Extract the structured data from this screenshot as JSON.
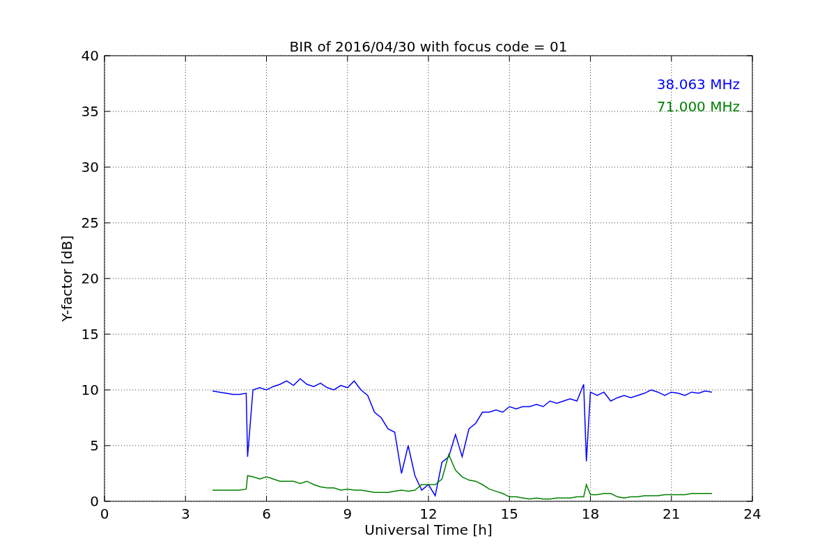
{
  "figure": {
    "chart_data": {
      "type": "line",
      "title": "BIR of 2016/04/30 with focus code = 01",
      "xlabel": "Universal Time [h]",
      "ylabel": "Y-factor [dB]",
      "x": [
        4,
        4.25,
        4.5,
        4.75,
        5,
        5.25,
        5.3,
        5.5,
        5.75,
        6,
        6.25,
        6.5,
        6.75,
        7,
        7.25,
        7.5,
        7.75,
        8,
        8.25,
        8.5,
        8.75,
        9,
        9.25,
        9.5,
        9.75,
        10,
        10.25,
        10.5,
        10.75,
        11,
        11.25,
        11.5,
        11.75,
        12,
        12.25,
        12.5,
        12.75,
        13,
        13.25,
        13.5,
        13.75,
        14,
        14.25,
        14.5,
        14.75,
        15,
        15.25,
        15.5,
        15.75,
        16,
        16.25,
        16.5,
        16.75,
        17,
        17.25,
        17.5,
        17.75,
        17.85,
        18,
        18.25,
        18.5,
        18.75,
        19,
        19.25,
        19.5,
        19.75,
        20,
        20.25,
        20.5,
        20.75,
        21,
        21.25,
        21.5,
        21.75,
        22,
        22.25,
        22.5
      ],
      "series": [
        {
          "name": "38.063 MHz",
          "color": "#0000ff",
          "values": [
            9.9,
            9.8,
            9.7,
            9.6,
            9.6,
            9.7,
            4.0,
            10.0,
            10.2,
            10.0,
            10.3,
            10.5,
            10.8,
            10.4,
            11.0,
            10.5,
            10.3,
            10.6,
            10.2,
            10.0,
            10.4,
            10.2,
            10.8,
            10.0,
            9.5,
            8.0,
            7.5,
            6.5,
            6.2,
            2.5,
            5.0,
            2.3,
            1.0,
            1.5,
            0.5,
            3.5,
            4.0,
            6.0,
            4.0,
            6.5,
            7.0,
            8.0,
            8.0,
            8.2,
            8.0,
            8.5,
            8.3,
            8.5,
            8.5,
            8.7,
            8.5,
            9.0,
            8.8,
            9.0,
            9.2,
            9.0,
            10.5,
            3.6,
            9.8,
            9.5,
            9.8,
            9.0,
            9.3,
            9.5,
            9.3,
            9.5,
            9.7,
            10.0,
            9.8,
            9.5,
            9.8,
            9.7,
            9.5,
            9.8,
            9.7,
            9.9,
            9.8
          ]
        },
        {
          "name": "71.000 MHz",
          "color": "#008000",
          "values": [
            1.0,
            1.0,
            1.0,
            1.0,
            1.0,
            1.1,
            2.3,
            2.2,
            2.0,
            2.2,
            2.0,
            1.8,
            1.8,
            1.8,
            1.6,
            1.8,
            1.5,
            1.3,
            1.2,
            1.2,
            1.0,
            1.1,
            1.0,
            1.0,
            0.9,
            0.8,
            0.8,
            0.8,
            0.9,
            1.0,
            0.9,
            1.0,
            1.5,
            1.5,
            1.5,
            2.0,
            4.2,
            2.8,
            2.2,
            1.9,
            1.8,
            1.5,
            1.1,
            0.9,
            0.7,
            0.4,
            0.4,
            0.3,
            0.2,
            0.3,
            0.2,
            0.2,
            0.3,
            0.3,
            0.3,
            0.4,
            0.4,
            1.5,
            0.6,
            0.6,
            0.7,
            0.7,
            0.4,
            0.3,
            0.4,
            0.4,
            0.5,
            0.5,
            0.5,
            0.6,
            0.6,
            0.6,
            0.6,
            0.7,
            0.7,
            0.7,
            0.7
          ]
        }
      ],
      "grid": true,
      "xlim": [
        0,
        24
      ],
      "ylim": [
        0,
        40
      ],
      "xticks": [
        0,
        3,
        6,
        9,
        12,
        15,
        18,
        21,
        24
      ],
      "yticks": [
        0,
        5,
        10,
        15,
        20,
        25,
        30,
        35,
        40
      ]
    }
  }
}
